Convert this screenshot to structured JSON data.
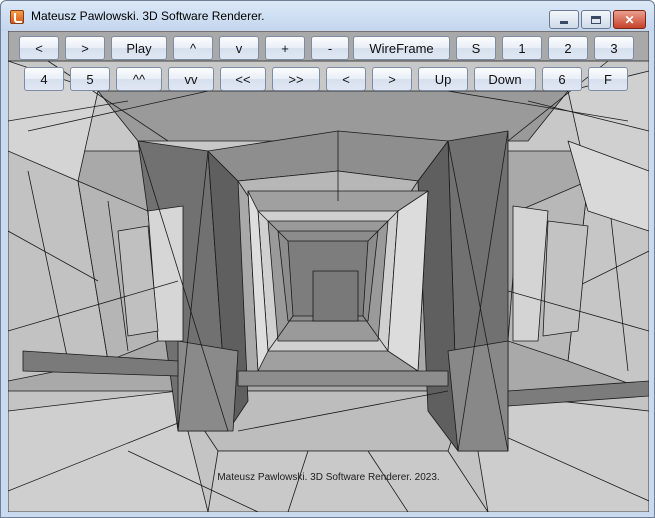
{
  "window": {
    "title": "Mateusz Pawlowski. 3D Software Renderer.",
    "controls": {
      "minimize": "",
      "maximize": "",
      "close": "✕"
    }
  },
  "toolbar": {
    "row1": [
      "<",
      ">",
      "Play",
      "^",
      "v",
      "+",
      "-",
      "WireFrame",
      "S",
      "1",
      "2",
      "3"
    ],
    "row2": [
      "4",
      "5",
      "^^",
      "vv",
      "<<",
      ">>",
      "<",
      ">",
      "Up",
      "Down",
      "6",
      "F"
    ]
  },
  "viewport": {
    "caption": "Mateusz Pawlowski. 3D Software Renderer. 2023."
  },
  "colors": {
    "light_face": "#d2d2d2",
    "mid_face": "#a8a8a8",
    "dark_face": "#6e6e6e",
    "edge": "#1a1a1a"
  }
}
